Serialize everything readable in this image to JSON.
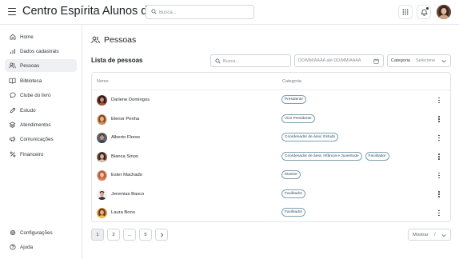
{
  "app": {
    "title": "Centro Espírita Alunos do Bem"
  },
  "topbar": {
    "search_placeholder": "Busca..."
  },
  "sidebar": {
    "items": [
      {
        "label": "Home",
        "icon": "home-icon"
      },
      {
        "label": "Dados cadastrais",
        "icon": "bar-chart-icon"
      },
      {
        "label": "Pessoas",
        "icon": "users-icon",
        "active": true
      },
      {
        "label": "Biblioteca",
        "icon": "book-open-icon"
      },
      {
        "label": "Clube do livro",
        "icon": "chat-bubble-icon"
      },
      {
        "label": "Estudo",
        "icon": "pencil-icon"
      },
      {
        "label": "Atendimentos",
        "icon": "layers-icon"
      },
      {
        "label": "Comunicações",
        "icon": "megaphone-icon"
      },
      {
        "label": "Financeiro",
        "icon": "percent-icon"
      }
    ],
    "bottom_items": [
      {
        "label": "Configurações",
        "icon": "gear-icon"
      },
      {
        "label": "Ajuda",
        "icon": "help-circle-icon"
      }
    ]
  },
  "page": {
    "title": "Pessoas",
    "list_title": "Lista de pessoas"
  },
  "filters": {
    "search_placeholder": "Busca...",
    "date_placeholder": "DD/MM/AAAA até DD/MM/AAAA",
    "category_label": "Categoria",
    "category_value": "Selecione"
  },
  "table": {
    "columns": [
      "Nome",
      "Categoria"
    ],
    "rows": [
      {
        "name": "Darlene Domingos",
        "categories": [
          "Presidente"
        ]
      },
      {
        "name": "Elenor Penha",
        "categories": [
          "Vice Presidente"
        ]
      },
      {
        "name": "Alberto Flores",
        "categories": [
          "Coordenador de área: Estudo"
        ]
      },
      {
        "name": "Bianca Sinos",
        "categories": [
          "Coordenador de área: Infância e Juventude",
          "Facilitador"
        ]
      },
      {
        "name": "Ester Machado",
        "categories": [
          "Monitor"
        ]
      },
      {
        "name": "Jeremias Basco",
        "categories": [
          "Facilitador"
        ]
      },
      {
        "name": "Laura Bono",
        "categories": [
          "Facilitador"
        ]
      }
    ]
  },
  "pagination": {
    "pages": [
      "1",
      "2",
      "...",
      "5"
    ],
    "current": "1",
    "next_icon": "chevron-right-icon",
    "show_label": "Mostrar",
    "show_value": "7"
  },
  "colors": {
    "badge_border": "#7f9fb2",
    "badge_text": "#2b4d61",
    "active_nav_bg": "#eef0f3"
  }
}
